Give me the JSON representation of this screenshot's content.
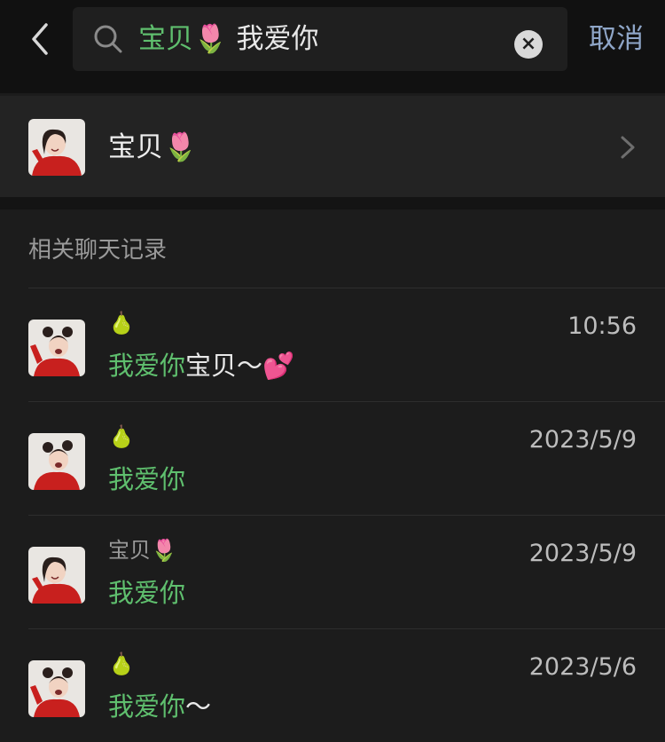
{
  "search": {
    "query_highlight": "宝贝🌷",
    "query_rest": " 我爱你",
    "cancel_label": "取消"
  },
  "contact": {
    "name": "宝贝🌷"
  },
  "section_title": "相关聊天记录",
  "chats": [
    {
      "sender": "🍐",
      "time": "10:56",
      "msg_highlight": "我爱你",
      "msg_rest": "宝贝～💕"
    },
    {
      "sender": "🍐",
      "time": "2023/5/9",
      "msg_highlight": "我爱你",
      "msg_rest": ""
    },
    {
      "sender": "宝贝🌷",
      "time": "2023/5/9",
      "msg_highlight": "我爱你",
      "msg_rest": ""
    },
    {
      "sender": "🍐",
      "time": "2023/5/6",
      "msg_highlight": "我爱你",
      "msg_rest": "～"
    }
  ],
  "colors": {
    "background": "#1c1c1c",
    "header": "#111111",
    "highlight_green": "#5fbf6e",
    "cancel_blue": "#8fa6c8"
  }
}
